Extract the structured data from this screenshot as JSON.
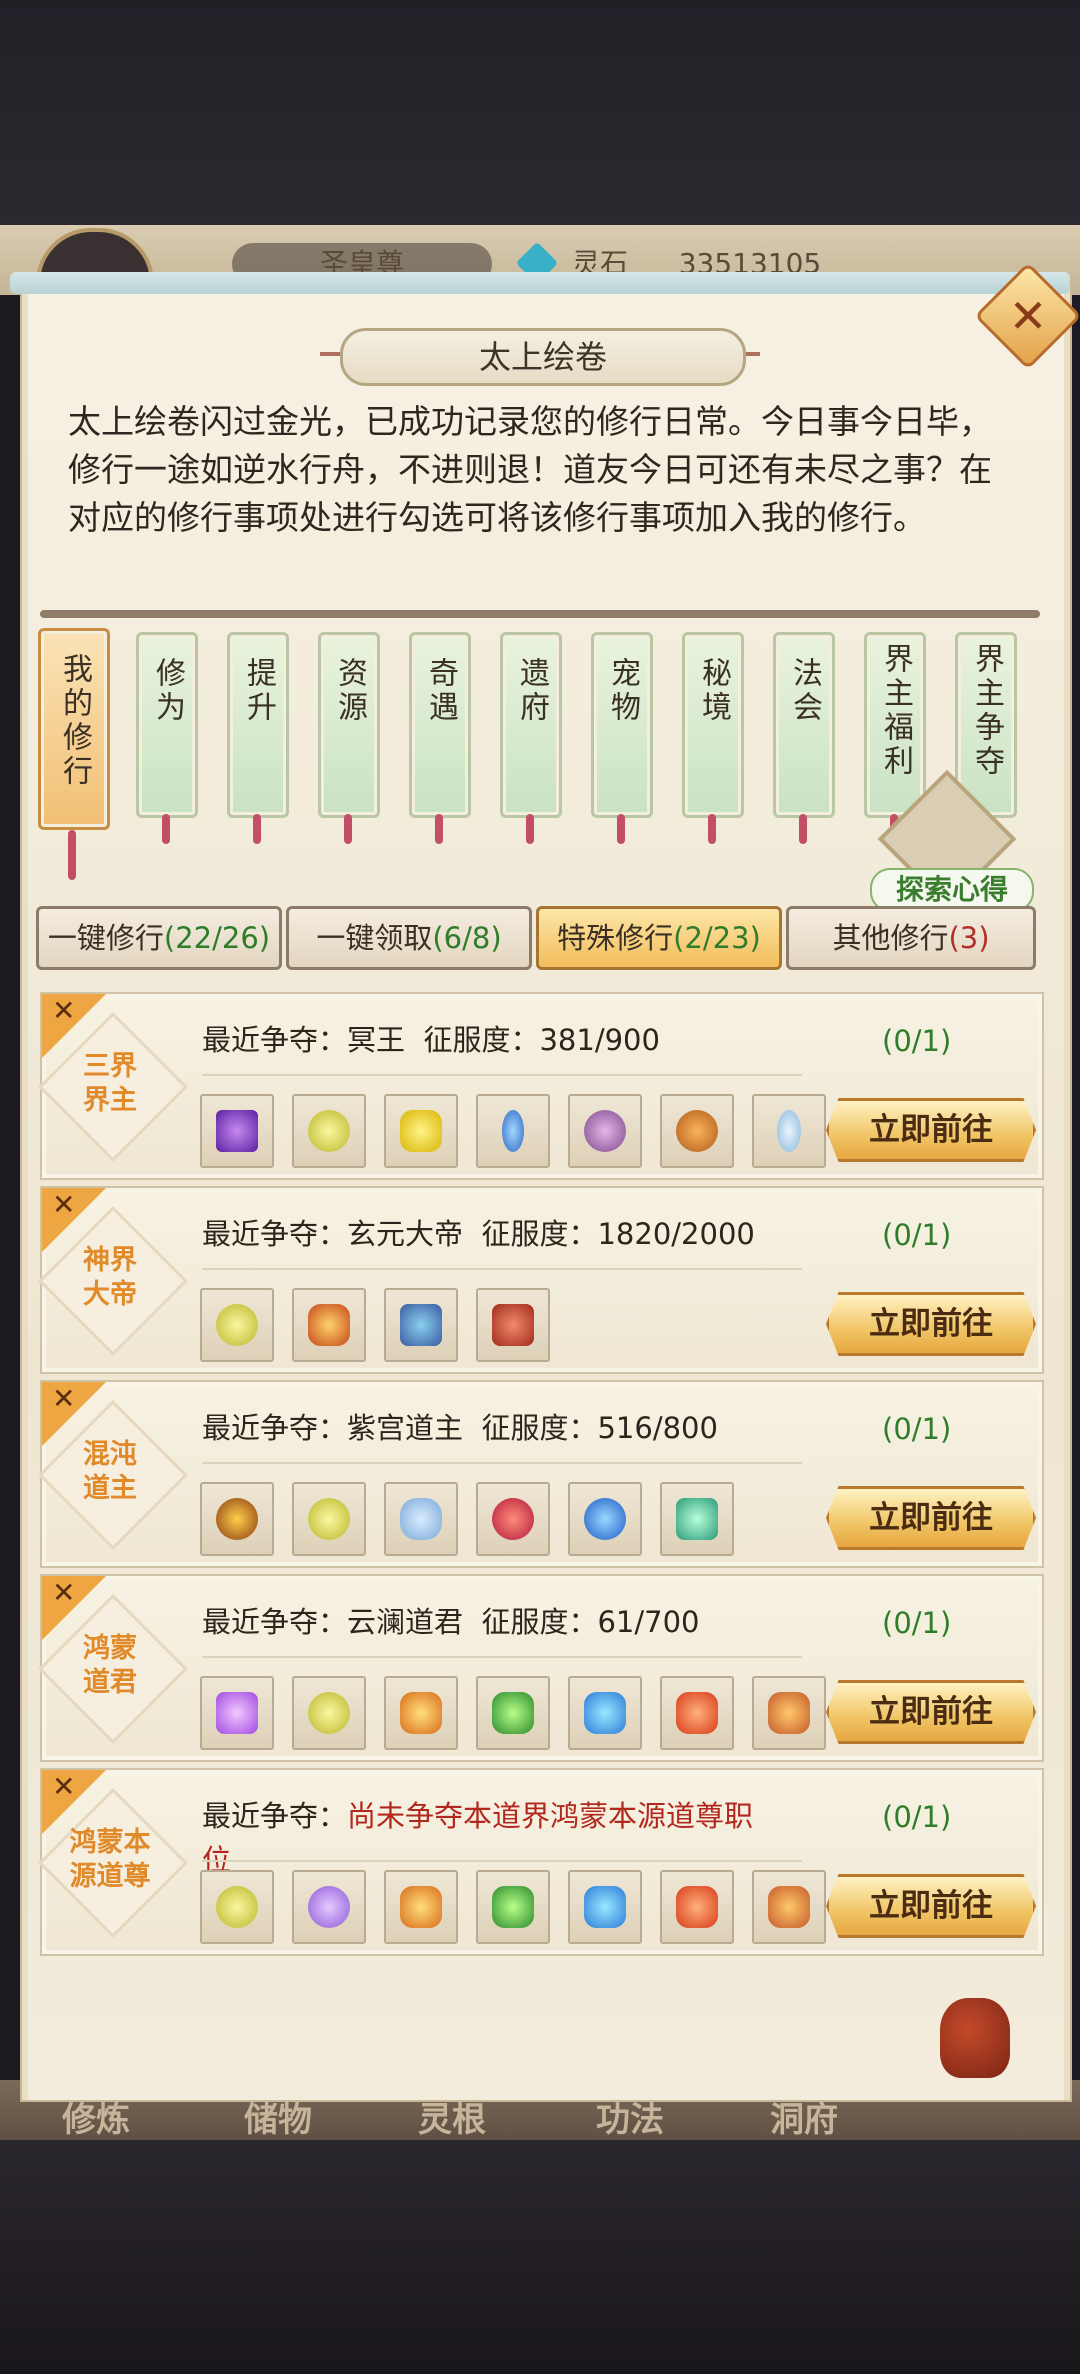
{
  "header": {
    "rank": "圣皇尊",
    "currency_label": "灵石",
    "currency_value": "33513105"
  },
  "panel": {
    "title": "太上绘卷",
    "description": "太上绘卷闪过金光，已成功记录您的修行日常。今日事今日毕，修行一途如逆水行舟，不进则退！道友今日可还有未尽之事？在对应的修行事项处进行勾选可将该修行事项加入我的修行。"
  },
  "banners": [
    "我的修行",
    "修为",
    "提升",
    "资源",
    "奇遇",
    "遗府",
    "宠物",
    "秘境",
    "法会",
    "界主福利",
    "界主争夺"
  ],
  "explore_label": "探索心得",
  "tabs": [
    {
      "label": "一键修行",
      "count": "(22/26)"
    },
    {
      "label": "一键领取",
      "count": "(6/8)"
    },
    {
      "label": "特殊修行",
      "count": "(2/23)"
    },
    {
      "label": "其他修行",
      "count": "(3)"
    }
  ],
  "cards": [
    {
      "badge": "三界界主",
      "prefix": "最近争夺：",
      "name": "冥王",
      "conquest": "征服度：381/900",
      "progress": "(0/1)",
      "button": "立即前往"
    },
    {
      "badge": "神界大帝",
      "prefix": "最近争夺：",
      "name": "玄元大帝",
      "conquest": "征服度：1820/2000",
      "progress": "(0/1)",
      "button": "立即前往"
    },
    {
      "badge": "混沌道主",
      "prefix": "最近争夺：",
      "name": "紫宫道主",
      "conquest": "征服度：516/800",
      "progress": "(0/1)",
      "button": "立即前往"
    },
    {
      "badge": "鸿蒙道君",
      "prefix": "最近争夺：",
      "name": "云澜道君",
      "conquest": "征服度：61/700",
      "progress": "(0/1)",
      "button": "立即前往"
    },
    {
      "badge": "鸿蒙本源道尊",
      "prefix": "最近争夺：",
      "notice": "尚未争夺本道界鸿蒙本源道尊职位",
      "progress": "(0/1)",
      "button": "立即前往"
    }
  ],
  "bottom_nav": [
    "修炼",
    "储物",
    "灵根",
    "功法",
    "洞府"
  ],
  "colors": {
    "accent_orange": "#e08a2a",
    "progress_green": "#2f7d2a",
    "notice_red": "#b2281f"
  },
  "icons": {
    "close": "close-icon",
    "explore": "scroll-icon"
  }
}
